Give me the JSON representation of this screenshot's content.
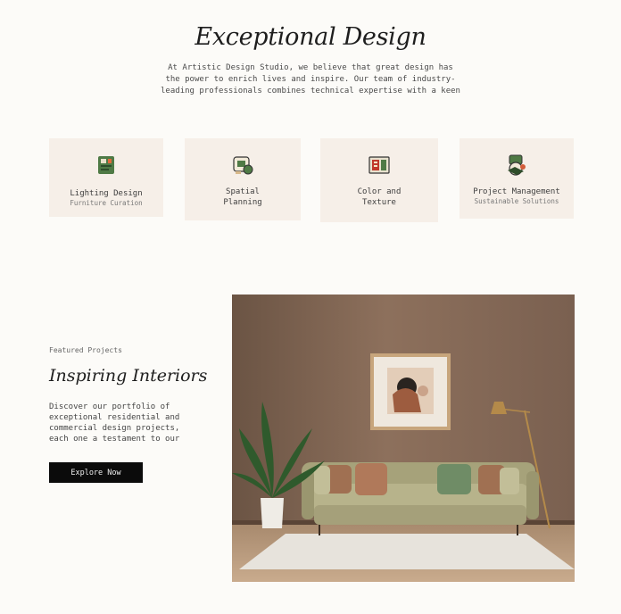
{
  "hero": {
    "title": "Exceptional Design",
    "intro": "At Artistic Design Studio, we believe that great design has the power to enrich lives and inspire. Our team of industry-leading professionals combines technical expertise with a keen"
  },
  "services": [
    {
      "title": "Lighting Design",
      "subtitle": "Furniture Curation",
      "icon": "lighting-icon"
    },
    {
      "title": "Spatial Planning",
      "subtitle": "",
      "icon": "spatial-planning-icon"
    },
    {
      "title": "Color and Texture",
      "subtitle": "",
      "icon": "color-texture-icon"
    },
    {
      "title": "Project Management",
      "subtitle": "Sustainable Solutions",
      "icon": "project-management-icon"
    }
  ],
  "featured": {
    "eyebrow": "Featured Projects",
    "heading": "Inspiring Interiors",
    "body": "Discover our portfolio of exceptional residential and commercial design projects, each one a testament to our",
    "button": "Explore Now"
  },
  "colors": {
    "background": "#fcfbf8",
    "card": "#f6efe8",
    "accent_green": "#4f7a45",
    "button": "#0b0b0b"
  }
}
